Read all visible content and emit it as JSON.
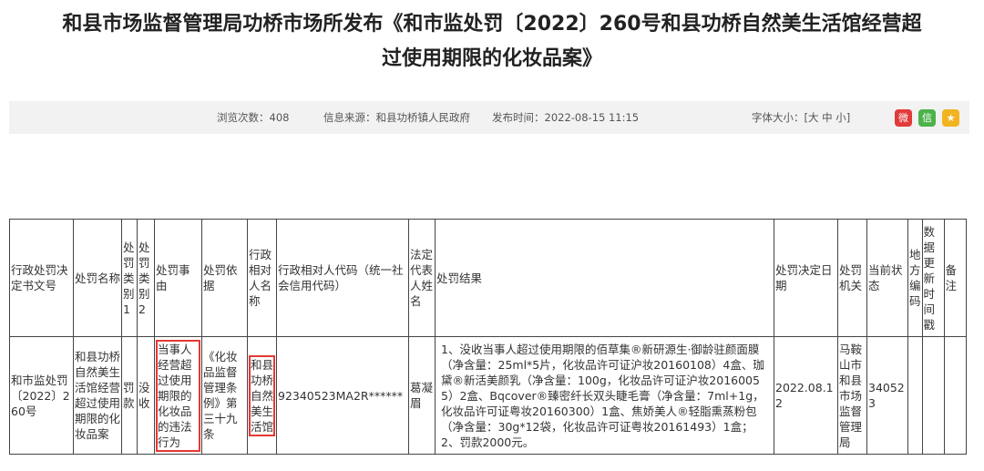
{
  "title": {
    "line1": "和县市场监督管理局功桥市场所发布《和市监处罚〔2022〕260号和县功桥自然美生活馆经营超",
    "line2": "过使用期限的化妆品案》"
  },
  "info": {
    "views": "浏览次数：408",
    "source": "信息来源：和县功桥镇人民政府",
    "published": "发布时间：2022-08-15  11:15",
    "font_size_label": "字体大小：",
    "font_size_options": "[大 中 小]"
  },
  "share": {
    "weibo": "微",
    "wechat": "信",
    "qzone": "★"
  },
  "table": {
    "headers": {
      "doc_no": "行政处罚决定书文号",
      "case_name": "处罚名称",
      "type1": "处罚类别1",
      "type2": "处罚类别2",
      "reason": "处罚事由",
      "basis": "处罚依据",
      "party_name": "行政相对人名称",
      "party_code": "行政相对人代码（统一社会信用代码）",
      "legal_rep": "法定代表人姓名",
      "result": "处罚结果",
      "decision_date": "处罚决定日期",
      "authority": "处罚机关",
      "status": "当前状态",
      "region_code": "地方编码",
      "update_time": "数据更新时间戳",
      "remark": "备注"
    },
    "row": {
      "doc_no": "和市监处罚〔2022〕260号",
      "case_name": "和县功桥自然美生活馆经营超过使用期限的化妆品案",
      "type1": "罚款",
      "type2": "没收",
      "reason": "当事人经营超过使用期限的化妆品的违法行为",
      "basis": "《化妆品监督管理条例》第三十九条",
      "party_name": "和县功桥自然美生活馆",
      "party_code": "92340523MA2R******",
      "legal_rep": "葛凝眉",
      "result": "1、没收当事人超过使用期限的佰草集®新研源生·御龄驻颜面膜（净含量：25ml*5片，化妆品许可证沪妆20160108）4盒、珈黛®新活美颜乳（净含量：100g，化妆品许可证沪妆20160055）2盒、Bqcover®臻密纤长双头睫毛膏（净含量：7ml+1g，化妆品许可证粤妆20160300）1盒、焦娇美人®轻脂熏蒸粉包（净含量：30g*12袋，化妆品许可证粤妆20161493）1盒； 2、罚款2000元。",
      "decision_date": "2022.08.12",
      "authority": "马鞍山市和县市场监督管理局",
      "status": "340523",
      "region_code": "",
      "update_time": "",
      "remark": ""
    }
  }
}
